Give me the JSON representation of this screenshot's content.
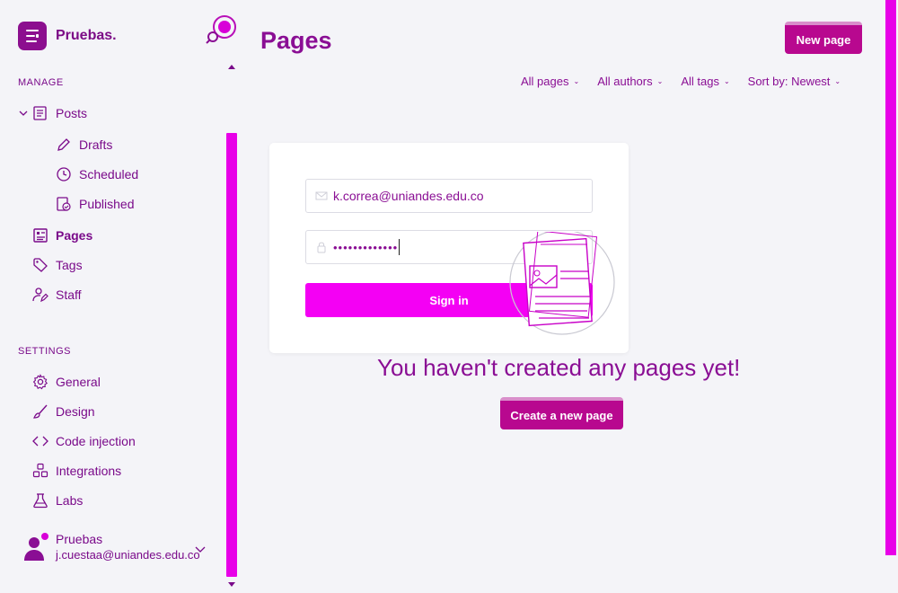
{
  "brand": {
    "name": "Pruebas."
  },
  "sidebar": {
    "manage_title": "MANAGE",
    "settings_title": "SETTINGS",
    "manage_items": [
      {
        "label": "Posts",
        "icon": "posts-icon"
      },
      {
        "label": "Drafts",
        "icon": "pencil-icon"
      },
      {
        "label": "Scheduled",
        "icon": "clock-icon"
      },
      {
        "label": "Published",
        "icon": "published-icon"
      },
      {
        "label": "Pages",
        "icon": "pages-icon",
        "active": true
      },
      {
        "label": "Tags",
        "icon": "tag-icon"
      },
      {
        "label": "Staff",
        "icon": "staff-icon"
      }
    ],
    "settings_items": [
      {
        "label": "General",
        "icon": "gear-icon"
      },
      {
        "label": "Design",
        "icon": "brush-icon"
      },
      {
        "label": "Code injection",
        "icon": "code-icon"
      },
      {
        "label": "Integrations",
        "icon": "integrations-icon"
      },
      {
        "label": "Labs",
        "icon": "flask-icon"
      }
    ]
  },
  "user": {
    "name": "Pruebas",
    "email": "j.cuestaa@uniandes.edu.co"
  },
  "header": {
    "title": "Pages",
    "new_button": "New page"
  },
  "filters": [
    "All pages",
    "All authors",
    "All tags",
    "Sort by: Newest"
  ],
  "signin": {
    "email_value": "k.correa@uniandes.edu.co",
    "password_masked": "•••••••••••••",
    "button": "Sign in"
  },
  "empty_state": {
    "message": "You haven't created any pages yet!",
    "button": "Create a new page"
  },
  "colors": {
    "accent": "#e800e8",
    "brand": "#8c0f8f",
    "text": "#7a0a8a",
    "background": "#f4f4f8"
  }
}
